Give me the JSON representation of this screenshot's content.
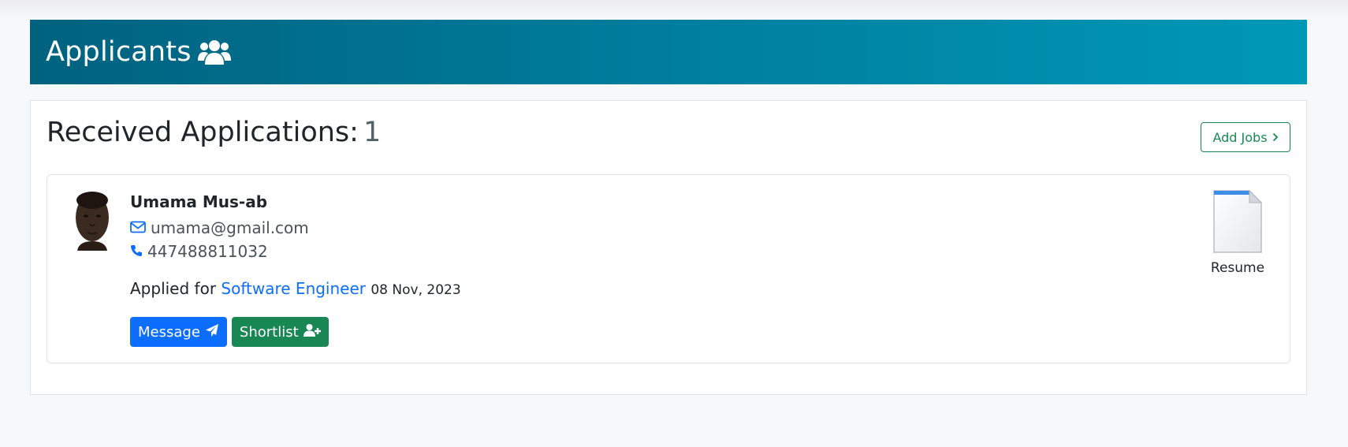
{
  "banner": {
    "title": "Applicants",
    "icon": "users-icon"
  },
  "panel": {
    "heading_label": "Received Applications:",
    "count": "1",
    "add_jobs_label": "Add Jobs"
  },
  "applicant": {
    "name": "Umama Mus-ab",
    "email": "umama@gmail.com",
    "phone": "447488811032",
    "applied_prefix": "Applied for",
    "job_title": "Software Engineer",
    "date": "08 Nov, 2023",
    "message_label": "Message",
    "shortlist_label": "Shortlist",
    "resume_label": "Resume"
  },
  "colors": {
    "banner_start": "#00627f",
    "banner_end": "#0098b7",
    "primary": "#0d6efd",
    "success": "#198754"
  }
}
